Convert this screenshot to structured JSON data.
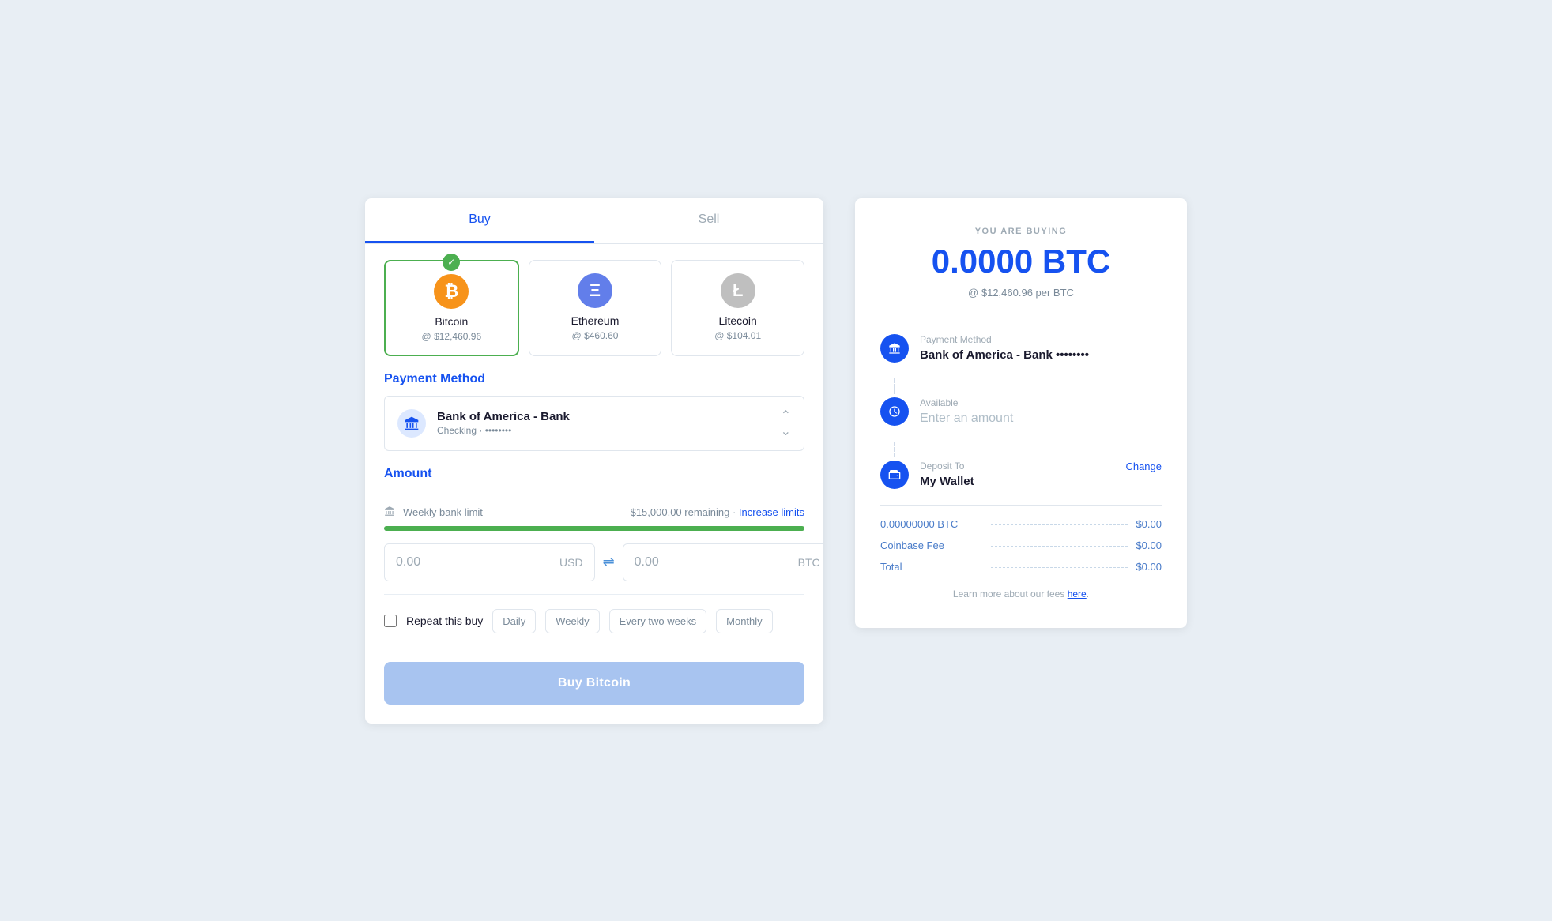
{
  "tabs": {
    "buy": "Buy",
    "sell": "Sell"
  },
  "cryptos": [
    {
      "id": "btc",
      "name": "Bitcoin",
      "price": "@ $12,460.96",
      "icon": "₿",
      "iconClass": "btc",
      "selected": true
    },
    {
      "id": "eth",
      "name": "Ethereum",
      "price": "@ $460.60",
      "icon": "Ξ",
      "iconClass": "eth",
      "selected": false
    },
    {
      "id": "ltc",
      "name": "Litecoin",
      "price": "@ $104.01",
      "icon": "Ł",
      "iconClass": "ltc",
      "selected": false
    }
  ],
  "payment": {
    "section_label": "Payment Method",
    "bank_name": "Bank of America - Bank",
    "bank_sub": "Checking · ••••••••"
  },
  "amount": {
    "section_label": "Amount",
    "limit_label": "Weekly bank limit",
    "limit_remaining": "$15,000.00 remaining",
    "limit_link": "Increase limits",
    "progress_pct": 100,
    "usd_value": "0.00",
    "usd_currency": "USD",
    "btc_value": "0.00",
    "btc_currency": "BTC",
    "repeat_label": "Repeat this buy",
    "freq_options": [
      "Daily",
      "Weekly",
      "Every two weeks",
      "Monthly"
    ]
  },
  "buy_button": {
    "label": "Buy Bitcoin"
  },
  "receipt": {
    "buying_label": "YOU ARE BUYING",
    "btc_amount": "0.0000 BTC",
    "btc_rate": "@ $12,460.96 per BTC",
    "payment_method_label": "Payment Method",
    "payment_method_value": "Bank of America - Bank ••••••••",
    "available_label": "Available",
    "available_placeholder": "Enter an amount",
    "deposit_label": "Deposit To",
    "deposit_value": "My Wallet",
    "change_link": "Change",
    "fees": [
      {
        "name": "0.00000000 BTC",
        "amount": "$0.00"
      },
      {
        "name": "Coinbase Fee",
        "amount": "$0.00"
      },
      {
        "name": "Total",
        "amount": "$0.00"
      }
    ],
    "fees_note_prefix": "Learn more about our fees ",
    "fees_note_link": "here",
    "fees_note_suffix": "."
  }
}
